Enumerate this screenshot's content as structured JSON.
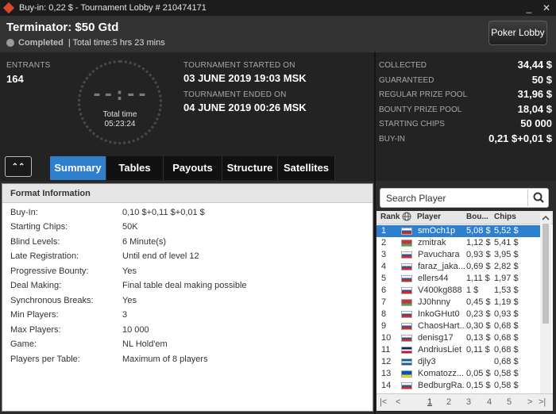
{
  "window": {
    "title": "Buy-in: 0,22 $ - Tournament Lobby # 210474171",
    "minimize": "_",
    "close": "✕"
  },
  "header": {
    "name": "Terminator: $50 Gtd",
    "status": "Completed",
    "total_time": "| Total time:5 hrs  23 mins",
    "lobby_button": "Poker Lobby"
  },
  "info": {
    "entrants_label": "ENTRANTS",
    "entrants_value": "164",
    "clock_digits": "--:--",
    "clock_label": "Total time",
    "clock_time": "05:23:24",
    "started_label": "TOURNAMENT STARTED ON",
    "started_value": "03 JUNE 2019  19:03 MSK",
    "ended_label": "TOURNAMENT ENDED ON",
    "ended_value": "04 JUNE 2019  00:26 MSK"
  },
  "stats": [
    {
      "label": "COLLECTED",
      "value": "34,44 $"
    },
    {
      "label": "GUARANTEED",
      "value": "50 $"
    },
    {
      "label": "REGULAR PRIZE POOL",
      "value": "31,96 $"
    },
    {
      "label": "BOUNTY PRIZE POOL",
      "value": "18,04 $"
    },
    {
      "label": "STARTING CHIPS",
      "value": "50 000"
    },
    {
      "label": "BUY-IN",
      "value": "0,21 $+0,01 $"
    }
  ],
  "tabs": [
    "Summary",
    "Tables",
    "Payouts",
    "Structure",
    "Satellites"
  ],
  "expand_icon": "⌃⌃",
  "format": {
    "title": "Format Information",
    "rows": [
      {
        "label": "Buy-In:",
        "value": "0,10 $+0,11 $+0,01 $"
      },
      {
        "label": "Starting Chips:",
        "value": "50K"
      },
      {
        "label": "Blind Levels:",
        "value": "6 Minute(s)"
      },
      {
        "label": "Late Registration:",
        "value": "Until end of level 12"
      },
      {
        "label": "Progressive Bounty:",
        "value": "Yes"
      },
      {
        "label": "Deal Making:",
        "value": "Final table deal making possible"
      },
      {
        "label": "Synchronous Breaks:",
        "value": "Yes"
      },
      {
        "label": "Min Players:",
        "value": "3"
      },
      {
        "label": "Max Players:",
        "value": "10 000"
      },
      {
        "label": "Game:",
        "value": "NL Hold'em"
      },
      {
        "label": "Players per Table:",
        "value": "Maximum of 8 players"
      }
    ]
  },
  "search": {
    "placeholder": "Search Player"
  },
  "player_list": {
    "headers": {
      "rank": "Rank",
      "player": "Player",
      "bounty": "Bou...",
      "chips": "Chips"
    },
    "rows": [
      {
        "rank": "1",
        "player": "smOch1p",
        "bounty": "5,08 $",
        "chips": "5,52 $",
        "flag": [
          "#ffffff",
          "#2451a6",
          "#d52b1e"
        ]
      },
      {
        "rank": "2",
        "player": "zmitrak",
        "bounty": "1,12 $",
        "chips": "5,41 $",
        "flag": [
          "#c8313e",
          "#c8313e",
          "#4aa657"
        ]
      },
      {
        "rank": "3",
        "player": "Pavuchara",
        "bounty": "0,93 $",
        "chips": "3,95 $",
        "flag": [
          "#ffffff",
          "#2451a6",
          "#d52b1e"
        ]
      },
      {
        "rank": "4",
        "player": "faraz_jaka...",
        "bounty": "0,69 $",
        "chips": "2,82 $",
        "flag": [
          "#ffffff",
          "#2451a6",
          "#d52b1e"
        ]
      },
      {
        "rank": "5",
        "player": "ellers44",
        "bounty": "1,11 $",
        "chips": "1,97 $",
        "flag": [
          "#ffffff",
          "#2451a6",
          "#d52b1e"
        ]
      },
      {
        "rank": "6",
        "player": "V400kg888",
        "bounty": "1 $",
        "chips": "1,53 $",
        "flag": [
          "#ffffff",
          "#2451a6",
          "#d52b1e"
        ]
      },
      {
        "rank": "7",
        "player": "JJ0hnny",
        "bounty": "0,45 $",
        "chips": "1,19 $",
        "flag": [
          "#c8313e",
          "#c8313e",
          "#4aa657"
        ]
      },
      {
        "rank": "8",
        "player": "InkoGHut0",
        "bounty": "0,23 $",
        "chips": "0,93 $",
        "flag": [
          "#ffffff",
          "#2451a6",
          "#d52b1e"
        ]
      },
      {
        "rank": "9",
        "player": "ChaosHart...",
        "bounty": "0,30 $",
        "chips": "0,68 $",
        "flag": [
          "#ffffff",
          "#2451a6",
          "#d52b1e"
        ]
      },
      {
        "rank": "10",
        "player": "denisg17",
        "bounty": "0,13 $",
        "chips": "0,68 $",
        "flag": [
          "#ffffff",
          "#2451a6",
          "#d52b1e"
        ]
      },
      {
        "rank": "11",
        "player": "AndriusLiet",
        "bounty": "0,11 $",
        "chips": "0,68 $",
        "flag": [
          "#012169",
          "#ffffff",
          "#c8102e"
        ]
      },
      {
        "rank": "12",
        "player": "djly3",
        "bounty": "",
        "chips": "0,68 $",
        "flag": [
          "#0d5eaf",
          "#ffffff",
          "#0d5eaf"
        ]
      },
      {
        "rank": "13",
        "player": "Komatozz...",
        "bounty": "0,05 $",
        "chips": "0,58 $",
        "flag": [
          "#0057b7",
          "#0057b7",
          "#ffd700"
        ]
      },
      {
        "rank": "14",
        "player": "BedburgRa...",
        "bounty": "0,15 $",
        "chips": "0,58 $",
        "flag": [
          "#ffffff",
          "#2451a6",
          "#d52b1e"
        ]
      }
    ]
  },
  "pager": {
    "first": "|<",
    "prev": "<",
    "pages": [
      "1",
      "2",
      "3",
      "4",
      "5"
    ],
    "next": ">",
    "last": ">|"
  },
  "colors": {
    "accent": "#2f7fcf",
    "background": "#232323"
  }
}
